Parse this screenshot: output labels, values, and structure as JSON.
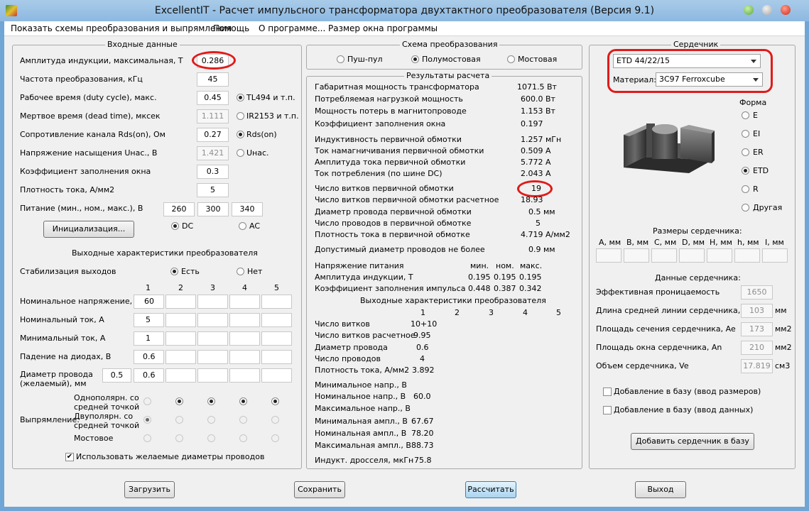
{
  "window": {
    "title": "ExcellentIT - Расчет импульсного трансформатора двухтактного преобразователя (Версия 9.1)"
  },
  "menu": [
    "Показать схемы преобразования и выпрямления",
    "Помощь",
    "О программе...",
    "Размер окна программы"
  ],
  "colors": {
    "highlight": "#e01b1b",
    "window_frame": "#8db8e0",
    "accent_button": "#a9d4f0"
  },
  "input": {
    "legend": "Входные данные",
    "induction": {
      "label": "Амплитуда индукции, максимальная, Т",
      "value": "0.286"
    },
    "freq": {
      "label": "Частота преобразования, кГц",
      "value": "45"
    },
    "duty": {
      "label": "Рабочее время (duty cycle), макс.",
      "value": "0.45"
    },
    "dead": {
      "label": "Мертвое время (dead time), мксек",
      "value": "1.111"
    },
    "rds": {
      "label": "Сопротивление канала Rds(on), Ом",
      "value": "0.27"
    },
    "usat": {
      "label": "Напряжение насыщения Uнас., В",
      "value": "1.421"
    },
    "fill": {
      "label": "Коэффициент заполнения окна",
      "value": "0.3"
    },
    "current_density": {
      "label": "Плотность тока, А/мм2",
      "value": "5"
    },
    "supply": {
      "label": "Питание (мин., ном., макс.), В",
      "min": "260",
      "nom": "300",
      "max": "340"
    },
    "ctrl_opts": [
      "TL494 и т.п.",
      "IR2153 и т.п.",
      "Rds(on)",
      "Uнас."
    ],
    "init_button": "Инициализация...",
    "dc": "DC",
    "ac": "AC"
  },
  "outputs": {
    "title": "Выходные характеристики преобразователя",
    "stab_label": "Стабилизация выходов",
    "stab_yes": "Есть",
    "stab_no": "Нет",
    "cols": [
      "1",
      "2",
      "3",
      "4",
      "5"
    ],
    "row_labels": [
      "Номинальное напряжение, В",
      "Номинальный ток, А",
      "Минимальный ток, А",
      "Падение на диодах, В"
    ],
    "row_values": [
      [
        "60",
        "",
        "",
        "",
        ""
      ],
      [
        "5",
        "",
        "",
        "",
        ""
      ],
      [
        "1",
        "",
        "",
        "",
        ""
      ],
      [
        "0.6",
        "",
        "",
        "",
        ""
      ]
    ],
    "diam_label_1": "Диаметр провода",
    "diam_label_2": "(желаемый), мм",
    "diam_left": "0.5",
    "diam_values": [
      "0.6",
      "",
      "",
      "",
      ""
    ],
    "rect_label": "Выпрямление:",
    "rect_opt1_a": "Однополярн. со",
    "rect_opt1_b": "средней точкой",
    "rect_opt2_a": "Двуполярн. со",
    "rect_opt2_b": "средней точкой",
    "rect_opt3": "Мостовое",
    "use_diam": "Использовать желаемые диаметры проводов"
  },
  "scheme": {
    "legend": "Схема преобразования",
    "opts": [
      "Пуш-пул",
      "Полумостовая",
      "Мостовая"
    ]
  },
  "results": {
    "legend": "Результаты расчета",
    "rows": [
      {
        "label": "Габаритная мощность трансформатора",
        "value": "1071.5 Вт"
      },
      {
        "label": "Потребляемая нагрузкой мощность",
        "value": "600.0 Вт"
      },
      {
        "label": "Мощность потерь в магнитопроводе",
        "value": "1.153 Вт"
      },
      {
        "label": "Коэффициент заполнения окна",
        "value": "0.197"
      },
      {
        "label": "Индуктивность первичной обмотки",
        "value": "1.257 мГн"
      },
      {
        "label": "Ток намагничивания первичной обмотки",
        "value": "0.509 А"
      },
      {
        "label": "Амплитуда тока первичной обмотки",
        "value": "5.772 А"
      },
      {
        "label": "Ток потребления (по шине DC)",
        "value": "2.043 А"
      },
      {
        "label": "Число витков первичной обмотки",
        "value": "19"
      },
      {
        "label": "Число витков первичной обмотки расчетное",
        "value": "18.93"
      },
      {
        "label": "Диаметр провода первичной обмотки",
        "value": "0.5 мм"
      },
      {
        "label": "Число проводов в первичной обмотке",
        "value": "5"
      },
      {
        "label": "Плотность тока в первичной обмотке",
        "value": "4.719 А/мм2"
      },
      {
        "label": "Допустимый диаметр проводов не более",
        "value": "0.9 мм"
      }
    ],
    "supply_table": {
      "title": "Напряжение питания",
      "headers": [
        "мин.",
        "ном.",
        "макс."
      ],
      "rows": [
        {
          "label": "Амплитуда индукции, Т",
          "values": [
            "0.195",
            "0.195",
            "0.195"
          ]
        },
        {
          "label": "Коэффициент заполнения импульса",
          "values": [
            "0.448",
            "0.387",
            "0.342"
          ]
        }
      ]
    },
    "out_title": "Выходные характеристики преобразователя",
    "out_cols": [
      "1",
      "2",
      "3",
      "4",
      "5"
    ],
    "out_rows": [
      {
        "label": "Число витков",
        "value": "10+10"
      },
      {
        "label": "Число витков расчетное",
        "value": "9.95"
      },
      {
        "label": "Диаметр провода",
        "value": "0.6"
      },
      {
        "label": "Число проводов",
        "value": "4"
      },
      {
        "label": "Плотность тока, А/мм2",
        "value": "3.892"
      },
      {
        "label": "Минимальное напр., В",
        "value": ""
      },
      {
        "label": "Номинальное напр., В",
        "value": "60.0"
      },
      {
        "label": "Максимальное напр., В",
        "value": ""
      },
      {
        "label": "Минимальная ампл., В",
        "value": "67.67"
      },
      {
        "label": "Номинальная ампл., В",
        "value": "78.20"
      },
      {
        "label": "Максимальная ампл., В",
        "value": "88.73"
      },
      {
        "label": "Индукт. дросселя, мкГн",
        "value": "75.8"
      }
    ]
  },
  "core": {
    "legend": "Сердечник",
    "model": "ETD 44/22/15",
    "material_label": "Материал:",
    "material": "3C97 Ferroxcube",
    "shape_label": "Форма",
    "shapes": [
      "E",
      "EI",
      "ER",
      "ETD",
      "R",
      "Другая"
    ],
    "dims_title": "Размеры сердечника:",
    "dims": [
      "A, мм",
      "B, мм",
      "C, мм",
      "D, мм",
      "H, мм",
      "h, мм",
      "I, мм"
    ],
    "data_title": "Данные сердечника:",
    "params": [
      {
        "label": "Эффективная проницаемость",
        "value": "1650",
        "unit": ""
      },
      {
        "label": "Длина средней линии сердечника, le",
        "value": "103",
        "unit": "мм"
      },
      {
        "label": "Площадь сечения сердечника, Ae",
        "value": "173",
        "unit": "мм2"
      },
      {
        "label": "Площадь окна сердечника, An",
        "value": "210",
        "unit": "мм2"
      },
      {
        "label": "Объем сердечника, Ve",
        "value": "17.819",
        "unit": "см3"
      }
    ],
    "add_dims": "Добавление в базу (ввод размеров)",
    "add_data": "Добавление в базу (ввод данных)",
    "add_button": "Добавить сердечник в базу"
  },
  "buttons": {
    "load": "Загрузить",
    "save": "Сохранить",
    "calc": "Рассчитать",
    "exit": "Выход"
  }
}
